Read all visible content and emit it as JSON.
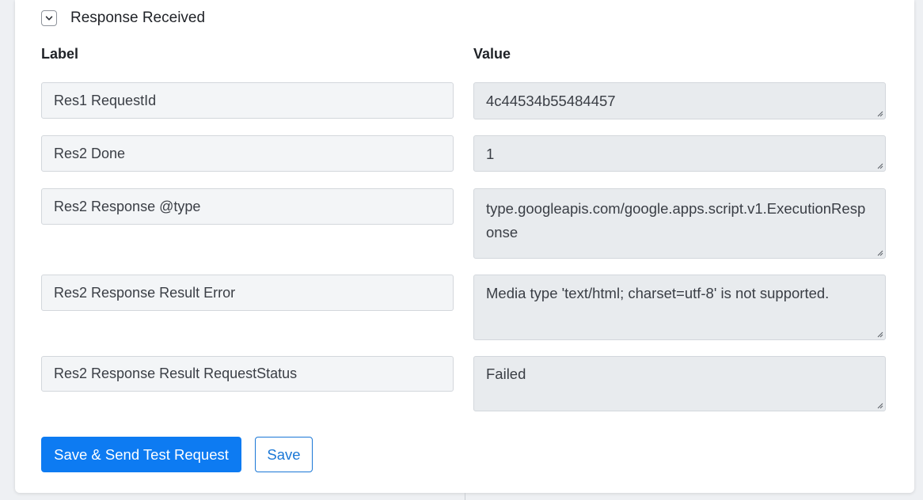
{
  "section": {
    "title": "Response Received",
    "toggle_icon": "chevron-down-icon"
  },
  "columns": {
    "label": "Label",
    "value": "Value"
  },
  "rows": [
    {
      "label": "Res1 RequestId",
      "value": "4c44534b55484457"
    },
    {
      "label": "Res2 Done",
      "value": "1"
    },
    {
      "label": "Res2 Response @type",
      "value": "type.googleapis.com/google.apps.script.v1.ExecutionResponse"
    },
    {
      "label": "Res2 Response Result Error",
      "value": "Media type 'text/html; charset=utf-8' is not supported."
    },
    {
      "label": "Res2 Response Result RequestStatus",
      "value": "Failed"
    }
  ],
  "buttons": {
    "save_send": "Save & Send Test Request",
    "save": "Save"
  },
  "colors": {
    "primary": "#0d7bf2",
    "outline": "#1a77d6"
  }
}
